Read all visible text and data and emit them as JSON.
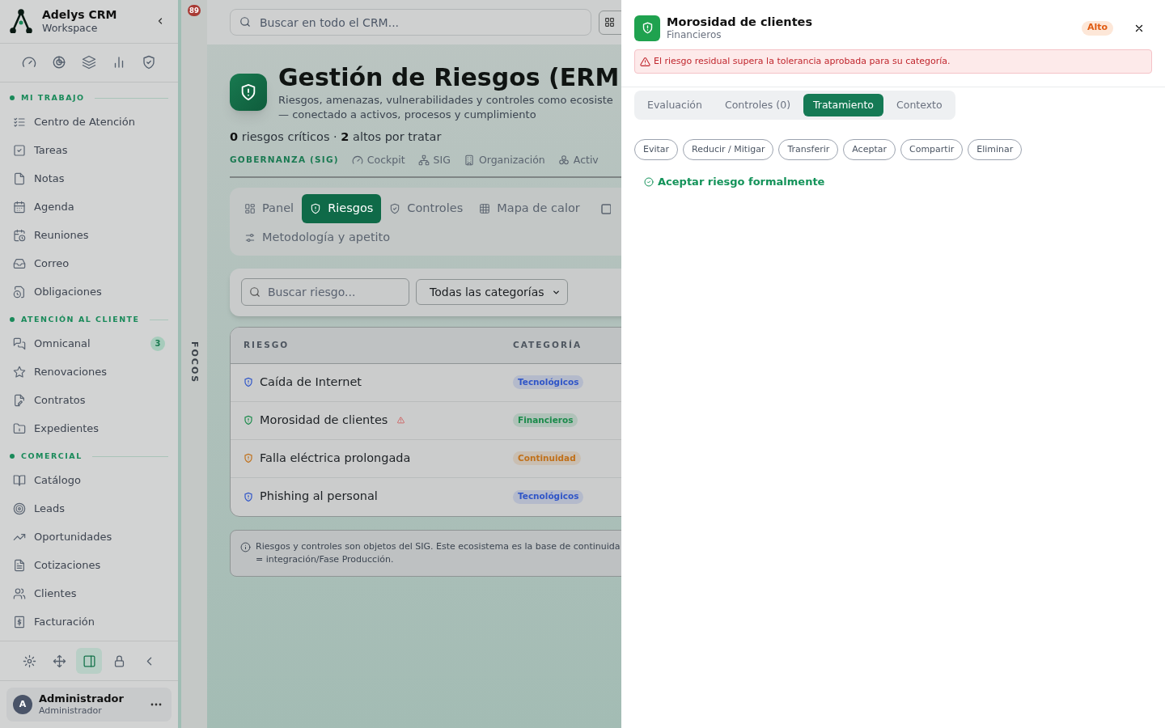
{
  "sidebar": {
    "brand": {
      "name": "Adelys CRM",
      "subtitle": "Workspace"
    },
    "sections": [
      {
        "title": "MI TRABAJO",
        "items": [
          {
            "label": "Centro de Atención",
            "selected": false
          },
          {
            "label": "Tareas",
            "selected": false
          },
          {
            "label": "Notas",
            "selected": false
          },
          {
            "label": "Agenda",
            "selected": false
          },
          {
            "label": "Reuniones",
            "selected": false
          },
          {
            "label": "Correo",
            "selected": false
          },
          {
            "label": "Obligaciones",
            "selected": false
          }
        ]
      },
      {
        "title": "ATENCIÓN AL CLIENTE",
        "items": [
          {
            "label": "Omnicanal",
            "badge": "3",
            "selected": false
          },
          {
            "label": "Renovaciones",
            "selected": false
          },
          {
            "label": "Contratos",
            "selected": false
          },
          {
            "label": "Expedientes",
            "selected": false
          }
        ]
      },
      {
        "title": "COMERCIAL",
        "items": [
          {
            "label": "Catálogo",
            "selected": false
          },
          {
            "label": "Leads",
            "selected": false
          },
          {
            "label": "Oportunidades",
            "selected": false
          },
          {
            "label": "Cotizaciones",
            "selected": false
          },
          {
            "label": "Clientes",
            "selected": false
          },
          {
            "label": "Facturación",
            "selected": false
          }
        ]
      }
    ],
    "toolbar": [
      {
        "selected": false
      },
      {
        "selected": false
      },
      {
        "selected": true
      },
      {
        "selected": false
      },
      {
        "selected": false
      }
    ],
    "user": {
      "avatar": "A",
      "name": "Administrador",
      "role": "Administrador"
    }
  },
  "focus_strip": {
    "badge": "89",
    "label": "FOCOS"
  },
  "topbar": {
    "search": {
      "placeholder": "Buscar en todo el CRM..."
    }
  },
  "header": {
    "title": "Gestión de Riesgos (ERM",
    "description": [
      "Riesgos, amenazas, vulnerabilidades y controles como ecosiste",
      "— conectado a activos, procesos y cumplimiento"
    ],
    "stats": "**0** riesgos críticos · **2** altos por tratar"
  },
  "governance": {
    "label": "GOBERNANZA (SIG)",
    "links": [
      "Cockpit",
      "SIG",
      "Organización",
      "Activ"
    ]
  },
  "tabs": [
    {
      "label": "Panel",
      "selected": false
    },
    {
      "label": "Riesgos",
      "selected": true
    },
    {
      "label": "Controles",
      "selected": false
    },
    {
      "label": "Mapa de calor",
      "selected": false
    },
    {
      "label": "Metodología y apetito",
      "selected": false
    }
  ],
  "filters": {
    "search": {
      "placeholder": "Buscar riesgo..."
    },
    "category": "Todas las categorías"
  },
  "table": {
    "columns": [
      "RIESGO",
      "CATEGORÍA"
    ],
    "rows": [
      {
        "name": "Caída de Internet",
        "category": "Tecnológicos",
        "color": "#2f55c8",
        "warning": false
      },
      {
        "name": "Morosidad de clientes",
        "category": "Financieros",
        "color": "#1a8a4a",
        "warning": true
      },
      {
        "name": "Falla eléctrica prolongada",
        "category": "Continuidad",
        "color": "#c0701a",
        "warning": false
      },
      {
        "name": "Phishing al personal",
        "category": "Tecnológicos",
        "color": "#2f55c8",
        "warning": false
      }
    ]
  },
  "note": [
    "Riesgos y controles son objetos del SIG. Este ecosistema es la base de continuida",
    "= integración/Fase Producción."
  ],
  "drawer": {
    "title": "Morosidad de clientes",
    "subtitle": "Financieros",
    "level": "Alto",
    "alert": "El riesgo residual supera la tolerancia aprobada para su categoría.",
    "tabs": [
      {
        "label": "Evaluación",
        "selected": false
      },
      {
        "label": "Controles (0)",
        "selected": false
      },
      {
        "label": "Tratamiento",
        "selected": true
      },
      {
        "label": "Contexto",
        "selected": false
      }
    ],
    "options": [
      {
        "label": "Evitar",
        "selected": false
      },
      {
        "label": "Reducir / Mitigar",
        "selected": false
      },
      {
        "label": "Transferir",
        "selected": false
      },
      {
        "label": "Aceptar",
        "selected": false
      },
      {
        "label": "Compartir",
        "selected": false
      },
      {
        "label": "Eliminar",
        "selected": false
      }
    ],
    "action": "Aceptar riesgo formalmente"
  }
}
